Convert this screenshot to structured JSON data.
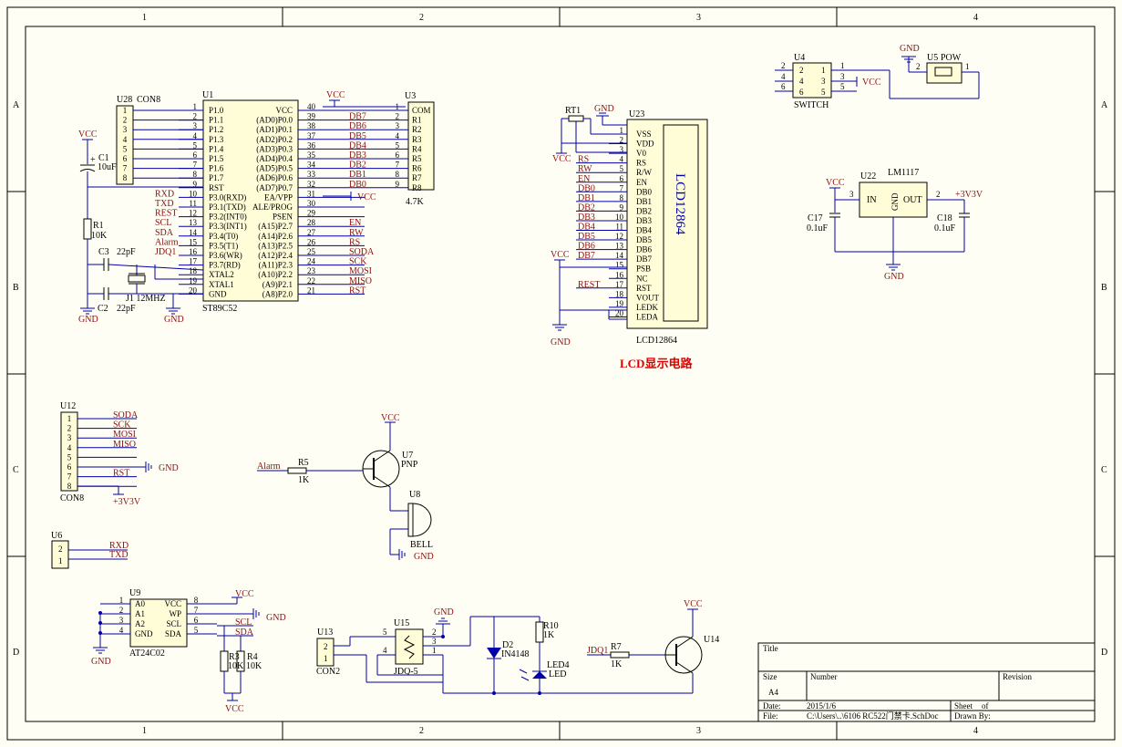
{
  "border": {
    "columns": [
      "1",
      "2",
      "3",
      "4"
    ],
    "rows": [
      "A",
      "B",
      "C",
      "D"
    ]
  },
  "title_block": {
    "title_label": "Title",
    "size_label": "Size",
    "size_value": "A4",
    "number_label": "Number",
    "revision_label": "Revision",
    "date_label": "Date:",
    "date_value": "2015/1/6",
    "file_label": "File:",
    "file_value": "C:\\Users\\..\\6106 RC522门禁卡.SchDoc",
    "sheet_label": "Sheet",
    "of_label": "of",
    "drawn_label": "Drawn By:"
  },
  "mcu": {
    "ref": "U1",
    "part": "ST89C52",
    "left_pins": [
      {
        "num": "1",
        "name": "P1.0"
      },
      {
        "num": "2",
        "name": "P1.1"
      },
      {
        "num": "3",
        "name": "P1.2"
      },
      {
        "num": "4",
        "name": "P1.3"
      },
      {
        "num": "5",
        "name": "P1.4"
      },
      {
        "num": "6",
        "name": "P1.5"
      },
      {
        "num": "7",
        "name": "P1.6"
      },
      {
        "num": "8",
        "name": "P1.7"
      },
      {
        "num": "9",
        "name": "RST"
      },
      {
        "num": "10",
        "name": "P3.0(RXD)"
      },
      {
        "num": "11",
        "name": "P3.1(TXD)"
      },
      {
        "num": "12",
        "name": "P3.2(INT0)"
      },
      {
        "num": "13",
        "name": "P3.3(INT1)"
      },
      {
        "num": "14",
        "name": "P3.4(T0)"
      },
      {
        "num": "15",
        "name": "P3.5(T1)"
      },
      {
        "num": "16",
        "name": "P3.6(WR)"
      },
      {
        "num": "17",
        "name": "P3.7(RD)"
      },
      {
        "num": "18",
        "name": "XTAL2"
      },
      {
        "num": "19",
        "name": "XTAL1"
      },
      {
        "num": "20",
        "name": "GND"
      }
    ],
    "left_nets": [
      "",
      "",
      "",
      "",
      "",
      "",
      "",
      "",
      "",
      "RXD",
      "TXD",
      "REST",
      "SCL",
      "SDA",
      "Alarm",
      "JDQ1",
      "",
      "",
      "",
      ""
    ],
    "right_pins": [
      {
        "num": "40",
        "name": "VCC"
      },
      {
        "num": "39",
        "name": "(AD0)P0.0"
      },
      {
        "num": "38",
        "name": "(AD1)P0.1"
      },
      {
        "num": "37",
        "name": "(AD2)P0.2"
      },
      {
        "num": "36",
        "name": "(AD3)P0.3"
      },
      {
        "num": "35",
        "name": "(AD4)P0.4"
      },
      {
        "num": "34",
        "name": "(AD5)P0.5"
      },
      {
        "num": "33",
        "name": "(AD6)P0.6"
      },
      {
        "num": "32",
        "name": "(AD7)P0.7"
      },
      {
        "num": "31",
        "name": "EA/VPP"
      },
      {
        "num": "30",
        "name": "ALE/PROG"
      },
      {
        "num": "29",
        "name": "PSEN"
      },
      {
        "num": "28",
        "name": "(A15)P2.7"
      },
      {
        "num": "27",
        "name": "(A14)P2.6"
      },
      {
        "num": "26",
        "name": "(A13)P2.5"
      },
      {
        "num": "25",
        "name": "(A12)P2.4"
      },
      {
        "num": "24",
        "name": "(A11)P2.3"
      },
      {
        "num": "23",
        "name": "(A10)P2.2"
      },
      {
        "num": "22",
        "name": "(A9)P2.1"
      },
      {
        "num": "21",
        "name": "(A8)P2.0"
      }
    ],
    "right_nets": [
      "",
      "DB7",
      "DB6",
      "DB5",
      "DB4",
      "DB3",
      "DB2",
      "DB1",
      "DB0",
      "",
      "",
      "",
      "EN",
      "RW",
      "RS",
      "SODA",
      "SCK",
      "MOSI",
      "MISO",
      "RST"
    ]
  },
  "con8_u28": {
    "ref": "U28",
    "part": "CON8",
    "pins": [
      "1",
      "2",
      "3",
      "4",
      "5",
      "6",
      "7",
      "8"
    ]
  },
  "rpack_u3": {
    "ref": "U3",
    "value": "4.7K",
    "pins": [
      {
        "num": "1",
        "name": "COM"
      },
      {
        "num": "2",
        "name": "R1"
      },
      {
        "num": "3",
        "name": "R2"
      },
      {
        "num": "4",
        "name": "R3"
      },
      {
        "num": "5",
        "name": "R4"
      },
      {
        "num": "6",
        "name": "R5"
      },
      {
        "num": "7",
        "name": "R6"
      },
      {
        "num": "8",
        "name": "R7"
      },
      {
        "num": "9",
        "name": "R8"
      }
    ]
  },
  "reset": {
    "c1_ref": "C1",
    "c1_value": "10uF",
    "r1_ref": "R1",
    "r1_value": "10K",
    "plus": "+"
  },
  "crystal": {
    "c3_ref": "C3",
    "c3_value": "22pF",
    "c2_ref": "C2",
    "c2_value": "22pF",
    "xtal": "J1 12MHZ"
  },
  "lcd": {
    "ref": "U23",
    "part": "LCD12864",
    "display_text": "LCD12864",
    "title": "LCD显示电路",
    "pot_ref": "RT1",
    "pins": [
      {
        "num": "1",
        "name": "VSS",
        "net": ""
      },
      {
        "num": "2",
        "name": "VDD",
        "net": ""
      },
      {
        "num": "3",
        "name": "V0",
        "net": ""
      },
      {
        "num": "4",
        "name": "RS",
        "net": "RS"
      },
      {
        "num": "5",
        "name": "R/W",
        "net": "RW"
      },
      {
        "num": "6",
        "name": "EN",
        "net": "EN"
      },
      {
        "num": "7",
        "name": "DB0",
        "net": "DB0"
      },
      {
        "num": "8",
        "name": "DB1",
        "net": "DB1"
      },
      {
        "num": "9",
        "name": "DB2",
        "net": "DB2"
      },
      {
        "num": "10",
        "name": "DB3",
        "net": "DB3"
      },
      {
        "num": "11",
        "name": "DB4",
        "net": "DB4"
      },
      {
        "num": "12",
        "name": "DB5",
        "net": "DB5"
      },
      {
        "num": "13",
        "name": "DB6",
        "net": "DB6"
      },
      {
        "num": "14",
        "name": "DB7",
        "net": "DB7"
      },
      {
        "num": "15",
        "name": "PSB",
        "net": ""
      },
      {
        "num": "16",
        "name": "NC",
        "net": ""
      },
      {
        "num": "17",
        "name": "RST",
        "net": "REST"
      },
      {
        "num": "18",
        "name": "VOUT",
        "net": ""
      },
      {
        "num": "19",
        "name": "LEDK",
        "net": ""
      },
      {
        "num": "20",
        "name": "LEDA",
        "net": ""
      }
    ]
  },
  "power_switch": {
    "u4_ref": "U4",
    "u4_label": "SWITCH",
    "u4_pins": [
      "1",
      "2",
      "3",
      "4",
      "5",
      "6"
    ],
    "u5_ref": "U5",
    "u5_label": "POW",
    "u5_pins": [
      "2",
      "1"
    ]
  },
  "regulator": {
    "ref": "U22",
    "part": "LM1117",
    "in_pin": "3",
    "in_name": "IN",
    "out_pin": "2",
    "out_name": "OUT",
    "gnd_name": "GND",
    "gnd_pin": "1",
    "c17_ref": "C17",
    "c17_value": "0.1uF",
    "c18_ref": "C18",
    "c18_value": "0.1uF",
    "out_net": "+3V3V"
  },
  "rfid_u12": {
    "ref": "U12",
    "part": "CON8",
    "pins": [
      "1",
      "2",
      "3",
      "4",
      "5",
      "6",
      "7",
      "8"
    ],
    "nets": [
      "SODA",
      "SCK",
      "MOSI",
      "MISO",
      "",
      "",
      "RST",
      ""
    ]
  },
  "buzzer": {
    "r5_ref": "R5",
    "r5_value": "1K",
    "alarm_net": "Alarm",
    "q_ref": "U7",
    "q_type": "PNP",
    "bell_ref": "U8",
    "bell_name": "BELL"
  },
  "uart_u6": {
    "ref": "U6",
    "pins": [
      "2",
      "1"
    ],
    "nets": [
      "RXD",
      "TXD"
    ]
  },
  "eeprom": {
    "ref": "U9",
    "part": "AT24C02",
    "left_pins": [
      {
        "num": "1",
        "name": "A0"
      },
      {
        "num": "2",
        "name": "A1"
      },
      {
        "num": "3",
        "name": "A2"
      },
      {
        "num": "4",
        "name": "GND"
      }
    ],
    "right_pins": [
      {
        "num": "8",
        "name": "VCC"
      },
      {
        "num": "7",
        "name": "WP"
      },
      {
        "num": "6",
        "name": "SCL"
      },
      {
        "num": "5",
        "name": "SDA"
      }
    ],
    "nets": [
      "SCL",
      "SDA"
    ],
    "r3_ref": "R3",
    "r3_value": "10K",
    "r4_ref": "R4",
    "r4_value": "10K"
  },
  "relay": {
    "u13_ref": "U13",
    "u13_part": "CON2",
    "u13_pins": [
      "2",
      "1"
    ],
    "u15_ref": "U15",
    "u15_part": "JDQ-5",
    "u15_pins": [
      "5",
      "4",
      "2",
      "3",
      "1"
    ],
    "d2_ref": "D2",
    "d2_part": "IN4148",
    "r10_ref": "R10",
    "r10_value": "1K",
    "led_ref": "LED4",
    "led_part": "LED",
    "r7_ref": "R7",
    "r7_value": "1K",
    "jdq_net": "JDQ1",
    "q_ref": "U14"
  },
  "power_labels": {
    "vcc": "VCC",
    "gnd": "GND",
    "v33": "+3V3V"
  }
}
